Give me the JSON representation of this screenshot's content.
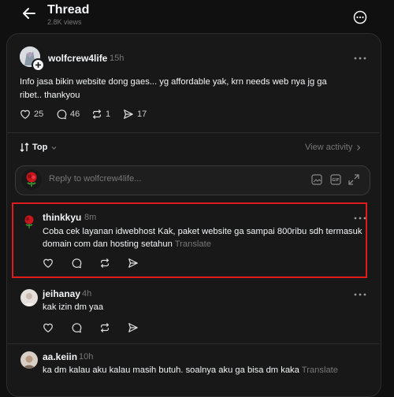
{
  "header": {
    "title": "Thread",
    "views": "2.8K views",
    "back_icon": "arrow-left-icon",
    "more_icon": "more-circle-icon"
  },
  "post": {
    "username": "wolfcrew4life",
    "time": "15h",
    "text_line1": "Info jasa bikin website dong gaes... yg affordable yak, krn needs web nya jg ga",
    "text_line2": "ribet.. thankyou",
    "likes": "25",
    "comments": "46",
    "reposts": "1",
    "shares": "17"
  },
  "sort": {
    "label": "Top",
    "view_activity": "View activity"
  },
  "reply_box": {
    "placeholder": "Reply to wolfcrew4life..."
  },
  "replies": [
    {
      "username": "thinkkyu",
      "time": "8m",
      "line1": "Coba cek layanan idwebhost Kak, paket website ga sampai 800ribu sdh termasuk",
      "line2": "domain com dan hosting setahun",
      "translate": "Translate"
    },
    {
      "username": "jeihanay",
      "time": "4h",
      "line1": "kak izin dm yaa"
    },
    {
      "username": "aa.keiin",
      "time": "10h",
      "line1": "ka dm kalau aku kalau masih butuh. soalnya aku ga bisa dm kaka",
      "translate": "Translate"
    }
  ],
  "colors": {
    "background": "#101010",
    "panel": "#181818",
    "highlight_border": "#e01b1b",
    "muted_text": "#777777"
  }
}
